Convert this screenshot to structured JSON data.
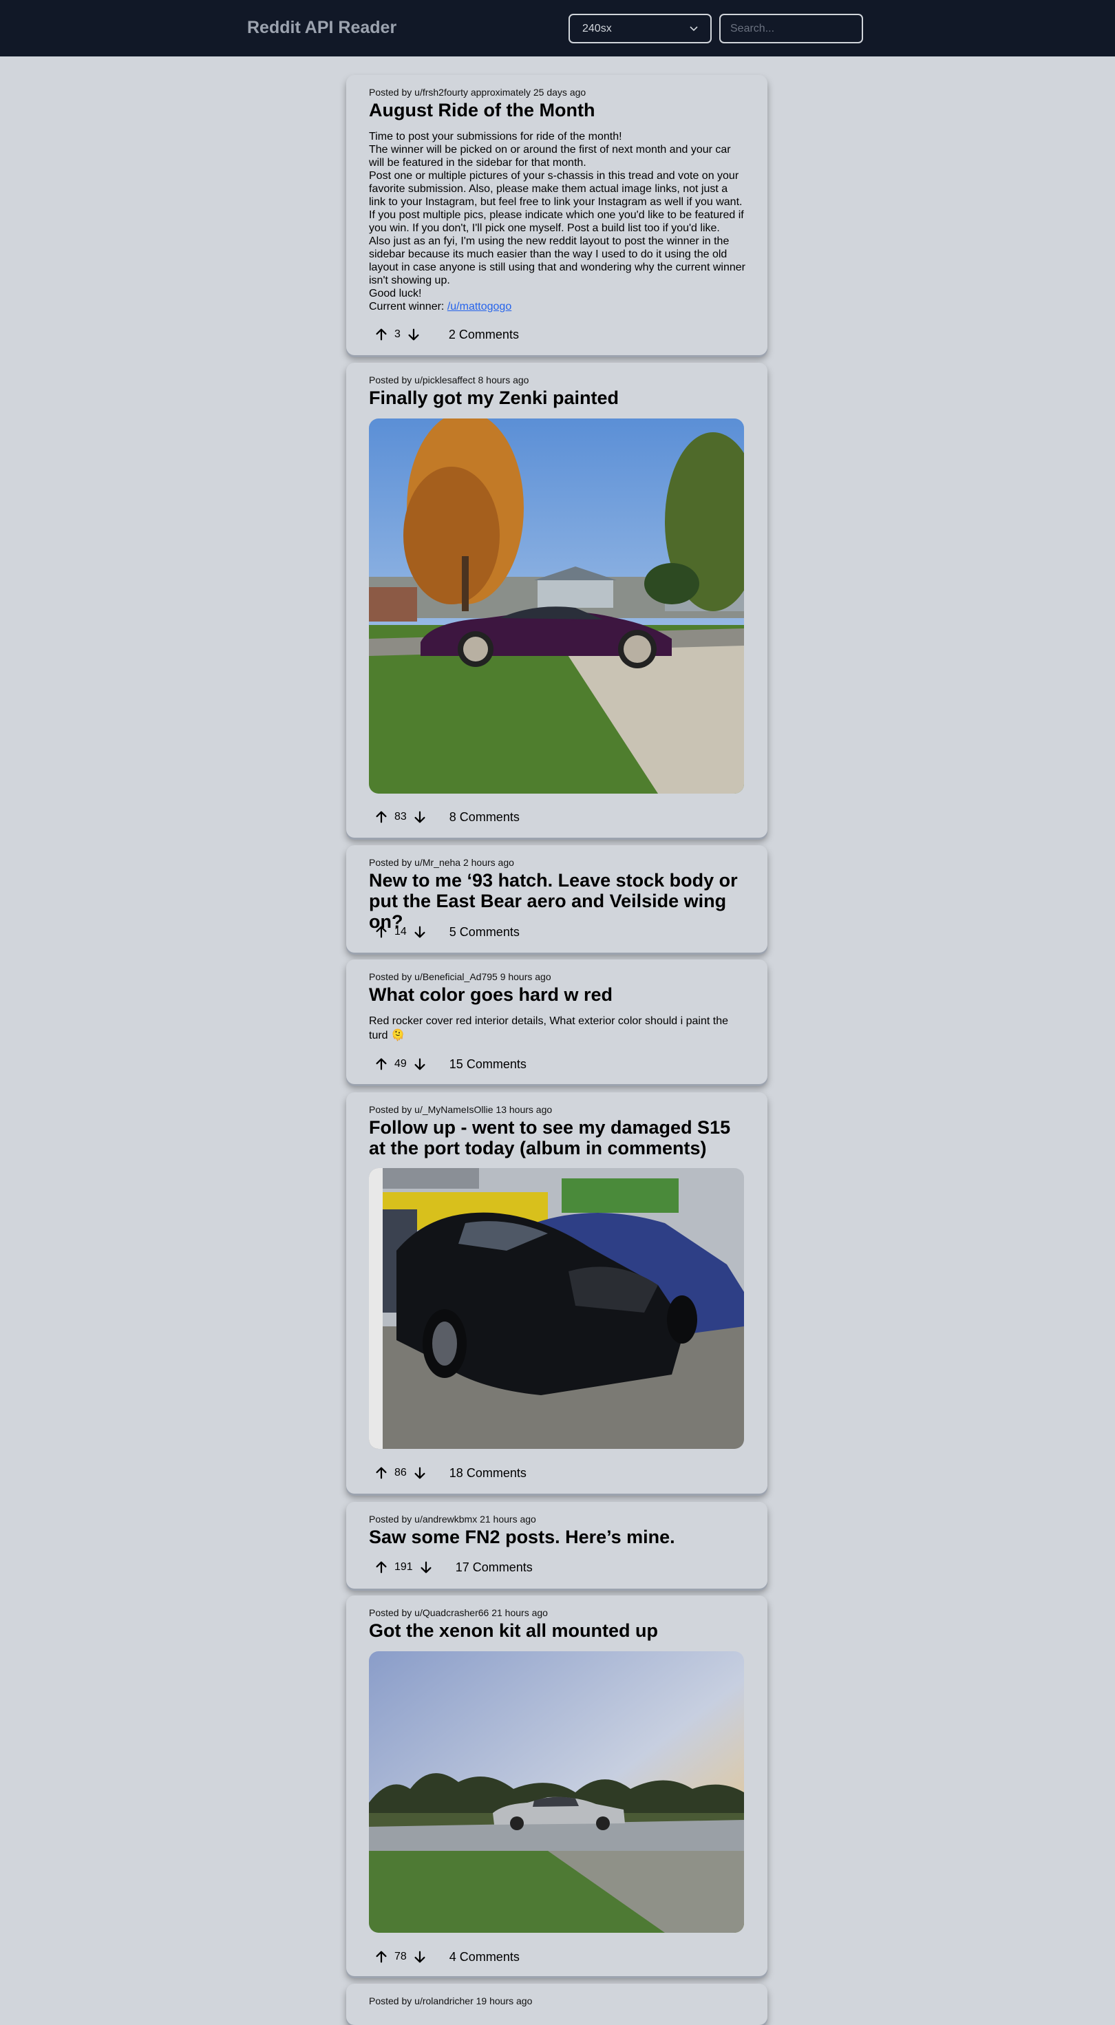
{
  "header": {
    "title": "Reddit API Reader",
    "subreddit": "240sx",
    "search_placeholder": "Search..."
  },
  "posts": [
    {
      "meta": "Posted by u/frsh2fourty approximately 25 days ago",
      "title": "August Ride of the Month",
      "body": [
        "Time to post your submissions for ride of the month!",
        "The winner will be picked on or around the first of next month and your car will be featured in the sidebar for that month.",
        "Post one or multiple pictures of your s-chassis in this tread and vote on your favorite submission. Also, please make them actual image links, not just a link to your Instagram, but feel free to link your Instagram as well if you want.",
        "If you post multiple pics, please indicate which one you'd like to be featured if you win. If you don't, I'll pick one myself. Post a build list too if you'd like.",
        "Also just as an fyi, I'm using the new reddit layout to post the winner in the sidebar because its much easier than the way I used to do it using the old layout in case anyone is still using that and wondering why the current winner isn't showing up.",
        "Good luck!"
      ],
      "winner_label": "Current winner: ",
      "winner_link": "/u/mattogogo",
      "score": "3",
      "comments": "2 Comments"
    },
    {
      "meta": "Posted by u/picklesaffect 8 hours ago",
      "title": "Finally got my Zenki painted",
      "score": "83",
      "comments": "8 Comments"
    },
    {
      "meta": "Posted by u/Mr_neha 2 hours ago",
      "title": "New to me ‘93 hatch. Leave stock body or put the East Bear aero and Veilside wing on?",
      "score": "14",
      "comments": "5 Comments"
    },
    {
      "meta": "Posted by u/Beneficial_Ad795 9 hours ago",
      "title": "What color goes hard w red",
      "body": "Red rocker cover red interior details, What exterior color should i paint the turd 🫠",
      "score": "49",
      "comments": "15 Comments"
    },
    {
      "meta": "Posted by u/_MyNameIsOllie 13 hours ago",
      "title": "Follow up - went to see my damaged S15 at the port today (album in comments)",
      "score": "86",
      "comments": "18 Comments"
    },
    {
      "meta": "Posted by u/andrewkbmx 21 hours ago",
      "title": "Saw some FN2 posts. Here’s mine.",
      "score": "191",
      "comments": "17 Comments"
    },
    {
      "meta": "Posted by u/Quadcrasher66 21 hours ago",
      "title": "Got the xenon kit all mounted up",
      "score": "78",
      "comments": "4 Comments"
    },
    {
      "meta": "Posted by u/rolandricher 19 hours ago"
    }
  ]
}
